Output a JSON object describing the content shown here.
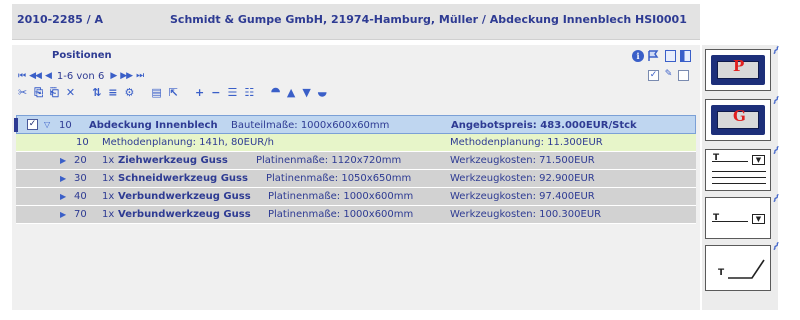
{
  "header": {
    "doc_id": "2010-2285 / A",
    "doc_title": "Schmidt & Gumpe GmbH, 21974-Hamburg, Müller / Abdeckung Innenblech HSI0001"
  },
  "panel": {
    "title": "Positionen",
    "pager": {
      "first": "⏮",
      "prev_page": "◀◀",
      "prev": "◀",
      "range": "1-6 von 6",
      "next": "▶",
      "next_page": "▶▶",
      "last": "⏭"
    },
    "toolbar_glyphs": [
      "✂",
      "⎘",
      "⎗",
      "✕",
      "⇅",
      "≡",
      "⚙",
      "▤",
      "⇱",
      "+",
      "−",
      "☰",
      "☷",
      "⯊",
      "▲",
      "▼",
      "⯋"
    ]
  },
  "rows": {
    "main": {
      "checked": "✓",
      "pos": "10",
      "name": "Abdeckung Innenblech",
      "dims": "Bauteilmaße: 1000x600x60mm",
      "price": "Angebotspreis: 483.000EUR/Stck"
    },
    "method": {
      "pos": "10",
      "desc": "Methodenplanung: 141h, 80EUR/h",
      "cost": "Methodenplanung: 11.300EUR"
    },
    "children": [
      {
        "pos": "20",
        "qty": "1x",
        "name": "Ziehwerkzeug Guss",
        "dims": "Platinenmaße: 1120x720mm",
        "cost": "Werkzeugkosten: 71.500EUR"
      },
      {
        "pos": "30",
        "qty": "1x",
        "name": "Schneidwerkzeug Guss",
        "dims": "Platinenmaße: 1050x650mm",
        "cost": "Werkzeugkosten: 92.900EUR"
      },
      {
        "pos": "40",
        "qty": "1x",
        "name": "Verbundwerkzeug Guss",
        "dims": "Platinenmaße: 1000x600mm",
        "cost": "Werkzeugkosten: 97.400EUR"
      },
      {
        "pos": "70",
        "qty": "1x",
        "name": "Verbundwerkzeug Guss",
        "dims": "Platinenmaße: 1000x600mm",
        "cost": "Werkzeugkosten: 100.300EUR"
      }
    ]
  },
  "sidebar": {
    "tile1_letter": "P",
    "tile2_letter": "G",
    "t_glyph": "T"
  },
  "colors": {
    "title_text": "#2e3b93",
    "main_row": "#bfd6f0",
    "method_row": "#e7f5c9",
    "child_row": "#d2d2d2",
    "mold": "#1d2f7a",
    "mold_letter": "#e02020"
  }
}
